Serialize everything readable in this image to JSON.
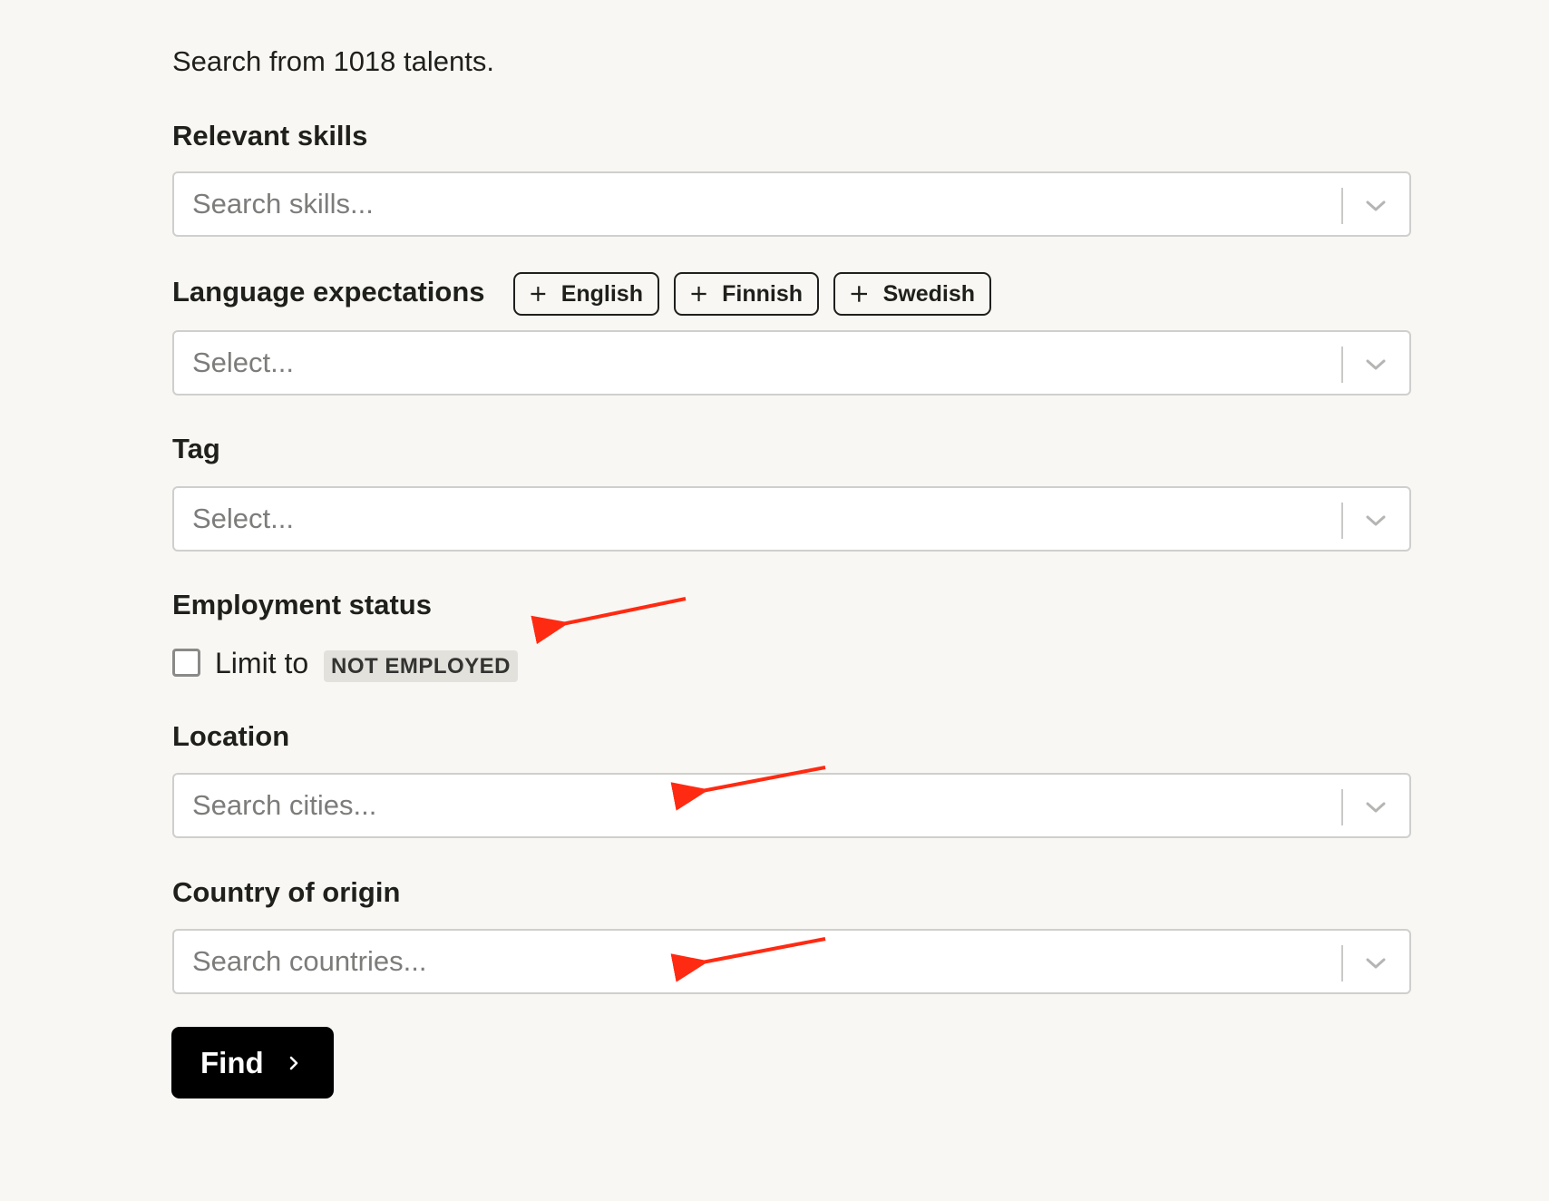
{
  "intro_text": "Search from 1018 talents.",
  "skills": {
    "label": "Relevant skills",
    "placeholder": "Search skills..."
  },
  "languages": {
    "label": "Language expectations",
    "quick_add": [
      "English",
      "Finnish",
      "Swedish"
    ],
    "placeholder": "Select..."
  },
  "tag": {
    "label": "Tag",
    "placeholder": "Select..."
  },
  "employment": {
    "label": "Employment status",
    "checkbox_label": "Limit to",
    "checked": false,
    "badge": "NOT EMPLOYED"
  },
  "location": {
    "label": "Location",
    "placeholder": "Search cities..."
  },
  "country": {
    "label": "Country of origin",
    "placeholder": "Search countries..."
  },
  "find_button": {
    "label": "Find"
  },
  "icons": {
    "dropdown": "chevron-down-icon",
    "add": "plus-icon",
    "submit": "chevron-right-icon"
  },
  "colors": {
    "background": "#f8f7f4",
    "annotation_arrow": "#ff2a12",
    "primary_button": "#000000",
    "badge_background": "#e2e1dc"
  }
}
